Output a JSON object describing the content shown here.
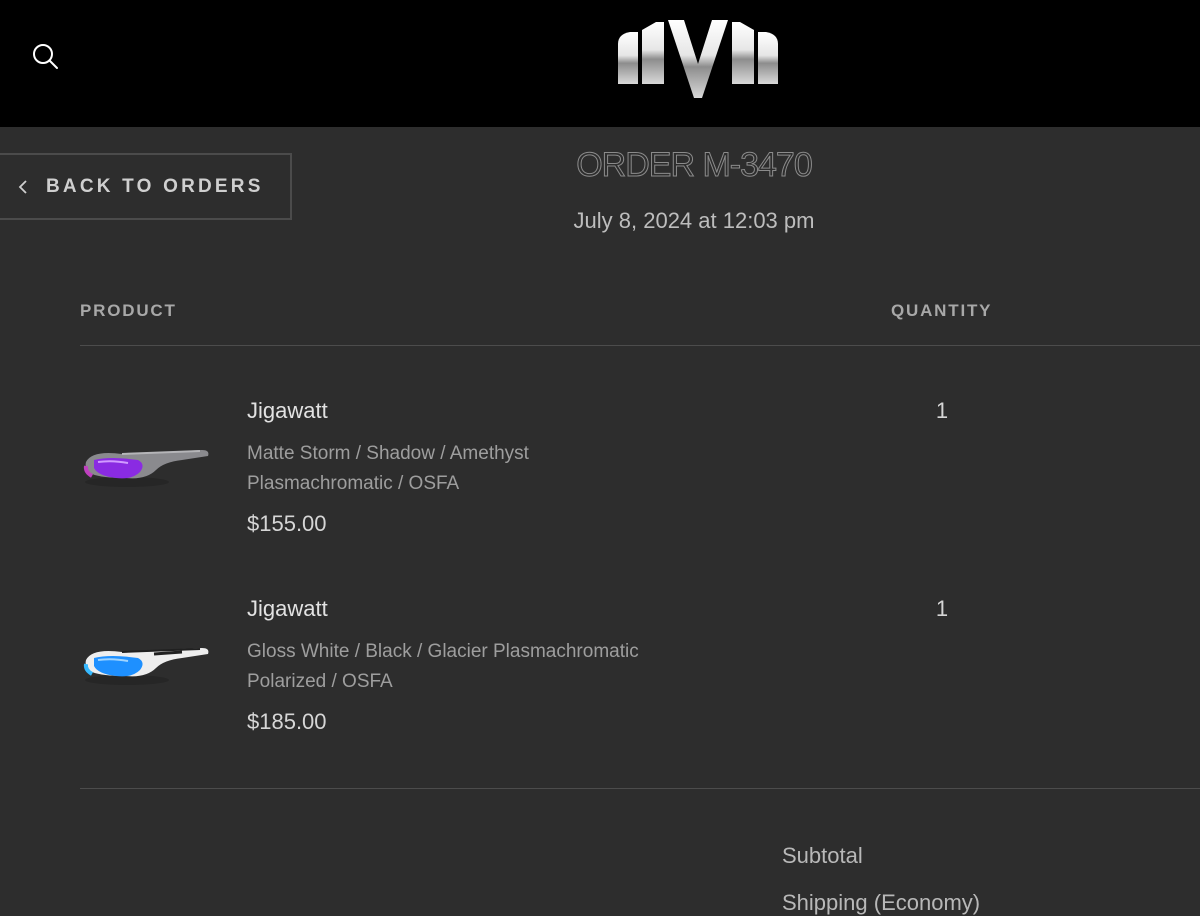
{
  "header": {
    "search_icon": "search-icon",
    "logo": "brand-m-logo"
  },
  "nav": {
    "back_label": "BACK TO ORDERS",
    "back_icon": "chevron-left-icon"
  },
  "order": {
    "title": "ORDER M-3470",
    "date": "July 8, 2024 at 12:03 pm"
  },
  "table": {
    "headers": {
      "product": "PRODUCT",
      "quantity": "QUANTITY"
    },
    "items": [
      {
        "name": "Jigawatt",
        "variant": "Matte Storm / Shadow / Amethyst Plasmachromatic / OSFA",
        "price": "$155.00",
        "quantity": "1",
        "image_icon": "sunglasses-amethyst-icon",
        "frame_color": "#8a8a8e",
        "lens_color": "#8a2be2"
      },
      {
        "name": "Jigawatt",
        "variant": "Gloss White / Black / Glacier Plasmachromatic Polarized / OSFA",
        "price": "$185.00",
        "quantity": "1",
        "image_icon": "sunglasses-glacier-icon",
        "frame_color": "#eeeeee",
        "lens_color": "#1e90ff"
      }
    ]
  },
  "summary": {
    "subtotal_label": "Subtotal",
    "shipping_label": "Shipping (Economy)"
  },
  "colors": {
    "background": "#2d2d2d",
    "topbar": "#000000",
    "text": "#d4d4d4"
  }
}
